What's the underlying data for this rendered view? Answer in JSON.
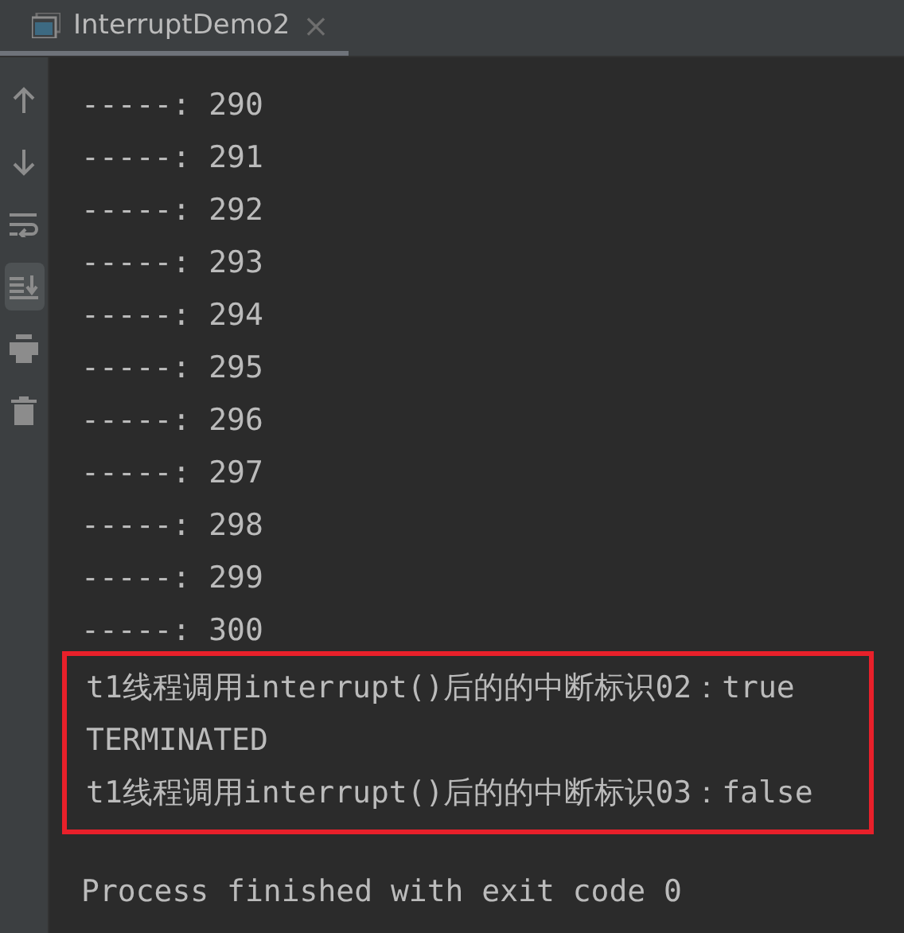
{
  "tab": {
    "title": "InterruptDemo2",
    "close": "×",
    "selected": true
  },
  "toolbar": [
    {
      "kind": "up",
      "selected": false
    },
    {
      "kind": "down",
      "selected": false
    },
    {
      "kind": "wrap",
      "selected": false
    },
    {
      "kind": "scroll-end",
      "selected": true
    },
    {
      "kind": "print",
      "selected": false
    },
    {
      "kind": "trash",
      "selected": false
    }
  ],
  "lines": [
    "-----: 290",
    "-----: 291",
    "-----: 292",
    "-----: 293",
    "-----: 294",
    "-----: 295",
    "-----: 296",
    "-----: 297",
    "-----: 298",
    "-----: 299",
    "-----: 300"
  ],
  "highlighted_lines": [
    "t1线程调用interrupt()后的的中断标识02：true",
    "TERMINATED",
    "t1线程调用interrupt()后的的中断标识03：false"
  ],
  "exit_message": "Process finished with exit code 0"
}
